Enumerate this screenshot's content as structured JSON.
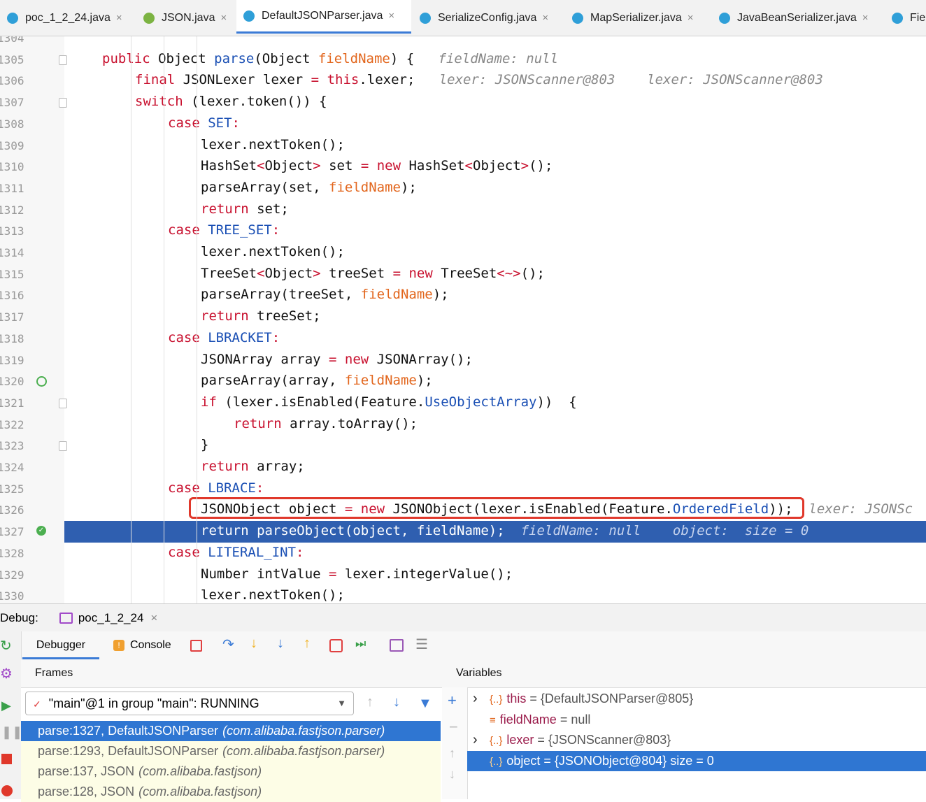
{
  "tabs": [
    {
      "label": "poc_1_2_24.java",
      "icon": "java-class-icon",
      "color": "#2f9fd8"
    },
    {
      "label": "JSON.java",
      "icon": "java-class-icon",
      "color": "#7cb342"
    },
    {
      "label": "DefaultJSONParser.java",
      "icon": "java-class-icon",
      "color": "#2f9fd8",
      "active": true
    },
    {
      "label": "SerializeConfig.java",
      "icon": "java-class-icon",
      "color": "#2f9fd8"
    },
    {
      "label": "MapSerializer.java",
      "icon": "java-class-icon",
      "color": "#2f9fd8"
    },
    {
      "label": "JavaBeanSerializer.java",
      "icon": "java-class-icon",
      "color": "#2f9fd8"
    },
    {
      "label": "Fie",
      "icon": "java-class-icon",
      "color": "#2f9fd8"
    }
  ],
  "close_glyph": "×",
  "lines": [
    {
      "n": "1304",
      "i": 0,
      "t": []
    },
    {
      "n": "1305",
      "i": 0,
      "t": [
        [
          "k",
          "public "
        ],
        [
          "",
          "Object "
        ],
        [
          "f",
          "parse"
        ],
        [
          "",
          "(Object "
        ],
        [
          "p",
          "fieldName"
        ],
        [
          "",
          ") {"
        ],
        [
          "h",
          "   fieldName: null"
        ]
      ]
    },
    {
      "n": "1306",
      "i": 1,
      "t": [
        [
          "k",
          "final "
        ],
        [
          "",
          "JSONLexer lexer "
        ],
        [
          "k",
          "= "
        ],
        [
          "k",
          "this"
        ],
        [
          "",
          ".lexer;"
        ],
        [
          "h",
          "   lexer: JSONScanner@803    lexer: JSONScanner@803"
        ]
      ]
    },
    {
      "n": "1307",
      "i": 1,
      "t": [
        [
          "k",
          "switch "
        ],
        [
          "",
          "(lexer.token()) {"
        ]
      ]
    },
    {
      "n": "1308",
      "i": 2,
      "t": [
        [
          "k",
          "case "
        ],
        [
          "f",
          "SET"
        ],
        [
          "k",
          ":"
        ]
      ]
    },
    {
      "n": "1309",
      "i": 3,
      "t": [
        [
          "",
          "lexer.nextToken();"
        ]
      ]
    },
    {
      "n": "1310",
      "i": 3,
      "t": [
        [
          "",
          "HashSet"
        ],
        [
          "k",
          "<"
        ],
        [
          "",
          "Object"
        ],
        [
          "k",
          "> "
        ],
        [
          "",
          "set "
        ],
        [
          "k",
          "= new "
        ],
        [
          "",
          "HashSet"
        ],
        [
          "k",
          "<"
        ],
        [
          "",
          "Object"
        ],
        [
          "k",
          ">"
        ],
        [
          "",
          "();"
        ]
      ]
    },
    {
      "n": "1311",
      "i": 3,
      "t": [
        [
          "",
          "parseArray(set, "
        ],
        [
          "p",
          "fieldName"
        ],
        [
          "",
          ");"
        ]
      ]
    },
    {
      "n": "1312",
      "i": 3,
      "t": [
        [
          "k",
          "return "
        ],
        [
          "",
          "set;"
        ]
      ]
    },
    {
      "n": "1313",
      "i": 2,
      "t": [
        [
          "k",
          "case "
        ],
        [
          "f",
          "TREE_SET"
        ],
        [
          "k",
          ":"
        ]
      ]
    },
    {
      "n": "1314",
      "i": 3,
      "t": [
        [
          "",
          "lexer.nextToken();"
        ]
      ]
    },
    {
      "n": "1315",
      "i": 3,
      "t": [
        [
          "",
          "TreeSet"
        ],
        [
          "k",
          "<"
        ],
        [
          "",
          "Object"
        ],
        [
          "k",
          "> "
        ],
        [
          "",
          "treeSet "
        ],
        [
          "k",
          "= new "
        ],
        [
          "",
          "TreeSet"
        ],
        [
          "k",
          "<~>"
        ],
        [
          "",
          "();"
        ]
      ]
    },
    {
      "n": "1316",
      "i": 3,
      "t": [
        [
          "",
          "parseArray(treeSet, "
        ],
        [
          "p",
          "fieldName"
        ],
        [
          "",
          ");"
        ]
      ]
    },
    {
      "n": "1317",
      "i": 3,
      "t": [
        [
          "k",
          "return "
        ],
        [
          "",
          "treeSet;"
        ]
      ]
    },
    {
      "n": "1318",
      "i": 2,
      "t": [
        [
          "k",
          "case "
        ],
        [
          "f",
          "LBRACKET"
        ],
        [
          "k",
          ":"
        ]
      ]
    },
    {
      "n": "1319",
      "i": 3,
      "t": [
        [
          "",
          "JSONArray array "
        ],
        [
          "k",
          "= new "
        ],
        [
          "",
          "JSONArray();"
        ]
      ]
    },
    {
      "n": "1320",
      "i": 3,
      "t": [
        [
          "",
          "parseArray(array, "
        ],
        [
          "p",
          "fieldName"
        ],
        [
          "",
          ");"
        ]
      ]
    },
    {
      "n": "1321",
      "i": 3,
      "t": [
        [
          "k",
          "if "
        ],
        [
          "",
          "(lexer.isEnabled(Feature."
        ],
        [
          "f",
          "UseObjectArray"
        ],
        [
          "",
          "))  {"
        ]
      ]
    },
    {
      "n": "1322",
      "i": 4,
      "t": [
        [
          "k",
          "return "
        ],
        [
          "",
          "array.toArray();"
        ]
      ]
    },
    {
      "n": "1323",
      "i": 3,
      "t": [
        [
          "",
          "}"
        ]
      ]
    },
    {
      "n": "1324",
      "i": 3,
      "t": [
        [
          "k",
          "return "
        ],
        [
          "",
          "array;"
        ]
      ]
    },
    {
      "n": "1325",
      "i": 2,
      "t": [
        [
          "k",
          "case "
        ],
        [
          "f",
          "LBRACE"
        ],
        [
          "k",
          ":"
        ]
      ]
    },
    {
      "n": "1326",
      "i": 3,
      "t": [
        [
          "",
          "JSONObject object "
        ],
        [
          "k",
          "= new "
        ],
        [
          "",
          "JSONObject(lexer.isEnabled(Feature."
        ],
        [
          "f",
          "OrderedField"
        ],
        [
          "",
          "));"
        ],
        [
          "h",
          "  lexer: JSONSc"
        ]
      ]
    },
    {
      "n": "1327",
      "i": 3,
      "t": [
        [
          "k",
          "return "
        ],
        [
          "",
          "parseObject(object, fieldName);"
        ],
        [
          "h",
          "  fieldName: null    object:  size = 0"
        ]
      ],
      "current": true
    },
    {
      "n": "1328",
      "i": 2,
      "t": [
        [
          "k",
          "case "
        ],
        [
          "f",
          "LITERAL_INT"
        ],
        [
          "k",
          ":"
        ]
      ]
    },
    {
      "n": "1329",
      "i": 3,
      "t": [
        [
          "",
          "Number intValue "
        ],
        [
          "k",
          "= "
        ],
        [
          "",
          "lexer.integerValue();"
        ]
      ]
    },
    {
      "n": "1330",
      "i": 3,
      "t": [
        [
          "",
          "lexer.nextToken();"
        ]
      ]
    }
  ],
  "debug": {
    "label": "Debug:",
    "session": "poc_1_2_24",
    "tab_debugger": "Debugger",
    "tab_console": "Console"
  },
  "frames": {
    "title": "Frames",
    "thread": "\"main\"@1 in group \"main\": RUNNING",
    "items": [
      {
        "method": "parse:1327, DefaultJSONParser",
        "pkg": "(com.alibaba.fastjson.parser)",
        "selected": true
      },
      {
        "method": "parse:1293, DefaultJSONParser",
        "pkg": "(com.alibaba.fastjson.parser)"
      },
      {
        "method": "parse:137, JSON",
        "pkg": "(com.alibaba.fastjson)"
      },
      {
        "method": "parse:128, JSON",
        "pkg": "(com.alibaba.fastjson)"
      }
    ]
  },
  "variables": {
    "title": "Variables",
    "items": [
      {
        "name": "this",
        "value": " = {DefaultJSONParser@805}",
        "expand": true,
        "icon": "object-icon"
      },
      {
        "name": "fieldName",
        "value": " = null",
        "expand": false,
        "icon": "field-icon"
      },
      {
        "name": "lexer",
        "value": " = {JSONScanner@803}",
        "expand": true,
        "icon": "object-icon"
      },
      {
        "name": "object",
        "value": " = {JSONObject@804}  size = 0",
        "expand": false,
        "icon": "object-icon",
        "selected": true
      }
    ]
  }
}
